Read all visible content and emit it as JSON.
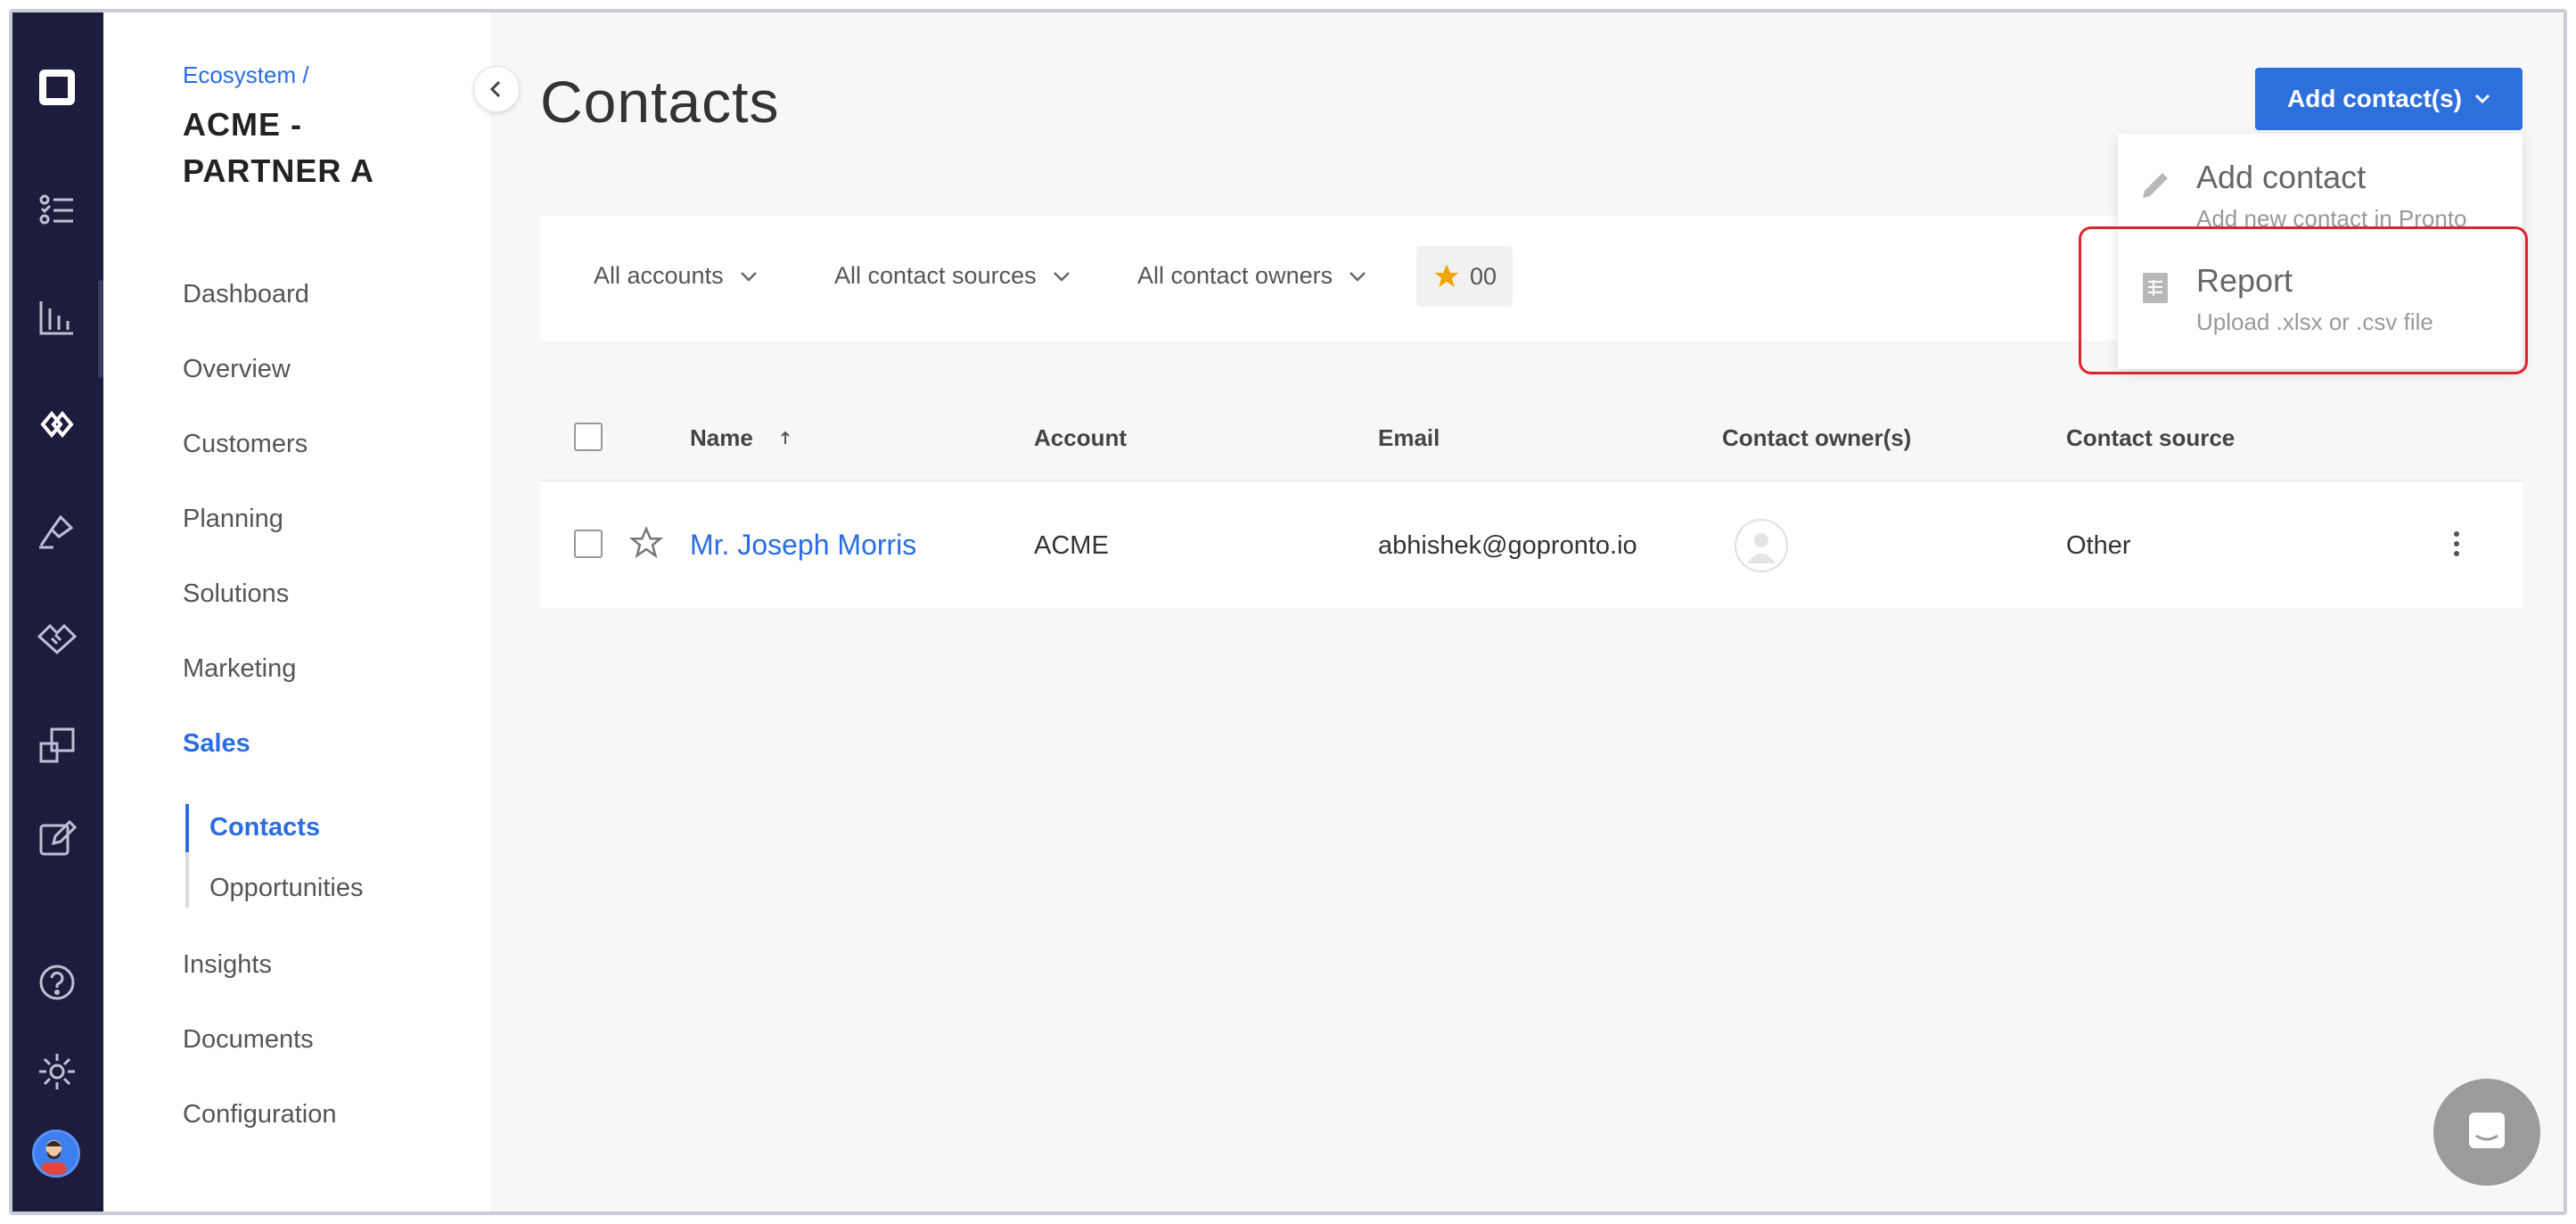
{
  "sidebar": {
    "breadcrumb": "Ecosystem /",
    "org_name": "ACME - PARTNER A",
    "items": [
      {
        "label": "Dashboard"
      },
      {
        "label": "Overview"
      },
      {
        "label": "Customers"
      },
      {
        "label": "Planning"
      },
      {
        "label": "Solutions"
      },
      {
        "label": "Marketing"
      },
      {
        "label": "Sales"
      }
    ],
    "sub_items": [
      {
        "label": "Contacts"
      },
      {
        "label": "Opportunities"
      }
    ],
    "items_after": [
      {
        "label": "Insights"
      },
      {
        "label": "Documents"
      },
      {
        "label": "Configuration"
      }
    ]
  },
  "rail_icons": [
    "logo-icon",
    "checklist-icon",
    "analytics-icon",
    "ecosystem-icon",
    "pen-icon",
    "handshake-icon",
    "pages-icon",
    "edit-icon",
    "help-icon",
    "settings-icon"
  ],
  "header": {
    "title": "Contacts",
    "add_button": "Add contact(s)"
  },
  "filters": {
    "accounts": "All accounts",
    "sources": "All contact sources",
    "owners": "All contact owners",
    "favorites_count": "00"
  },
  "table": {
    "columns": [
      "Name",
      "Account",
      "Email",
      "Contact owner(s)",
      "Contact source"
    ],
    "rows": [
      {
        "name": "Mr. Joseph Morris",
        "account": "ACME",
        "email": "abhishek@gopronto.io",
        "source": "Other"
      }
    ]
  },
  "dropdown": {
    "items": [
      {
        "title": "Add contact",
        "subtitle": "Add new contact in Pronto"
      },
      {
        "title": "Report",
        "subtitle": "Upload .xlsx or .csv file"
      }
    ]
  },
  "colors": {
    "accent": "#2e6fde",
    "rail": "#1e1c3d",
    "highlight": "#d9262c",
    "star": "#f0a500"
  }
}
